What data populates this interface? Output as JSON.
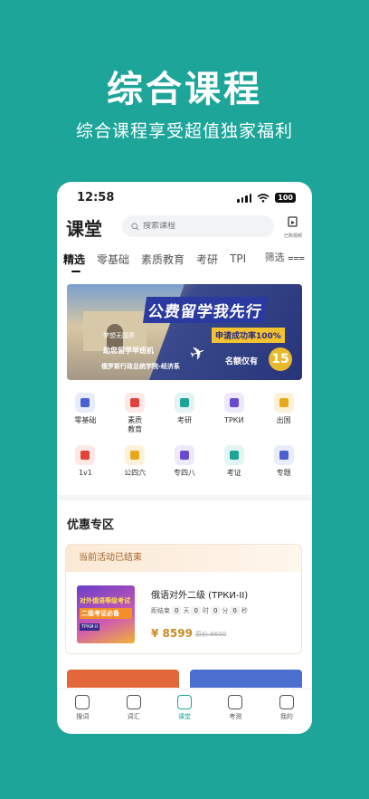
{
  "promo": {
    "title": "综合课程",
    "subtitle": "综合课程享受超值独家福利"
  },
  "status": {
    "time": "12:58",
    "battery": "100"
  },
  "header": {
    "title": "课堂",
    "search_placeholder": "搜索课程",
    "bought_label": "已购视频"
  },
  "tabs": [
    "精选",
    "零基础",
    "素质教育",
    "考研",
    "TPI"
  ],
  "filter_label": "筛选",
  "banner": {
    "title": "公费留学我先行",
    "tag1": "梦想无国界",
    "tag2": "助您留学早班机",
    "school": "俄罗斯行政总统学院-经济系",
    "rate": "申请成功率100%",
    "quota": "名额仅有",
    "quota_num": "15"
  },
  "categories": [
    [
      {
        "label": "零基础",
        "color": "#4a5fd0",
        "bg": "#e8ecfb"
      },
      {
        "label": "素质\n教育",
        "color": "#e2433a",
        "bg": "#fde8e6"
      },
      {
        "label": "考研",
        "color": "#1ea59a",
        "bg": "#e2f5f2"
      },
      {
        "label": "ТРКИ",
        "color": "#6a4bd0",
        "bg": "#eee9fb"
      },
      {
        "label": "出国",
        "color": "#e8a81c",
        "bg": "#fdf2d8"
      }
    ],
    [
      {
        "label": "1v1",
        "color": "#e2433a",
        "bg": "#fde8e6"
      },
      {
        "label": "公四六",
        "color": "#e8a81c",
        "bg": "#fdf2d8"
      },
      {
        "label": "专四八",
        "color": "#6a4bd0",
        "bg": "#eee9fb"
      },
      {
        "label": "考证",
        "color": "#1ea59a",
        "bg": "#e2f5f2"
      },
      {
        "label": "专题",
        "color": "#4a5fd0",
        "bg": "#e8ecfb"
      }
    ]
  ],
  "deals": {
    "section_title": "优惠专区",
    "status": "当前活动已结束",
    "course": {
      "title": "俄语对外二级 (ТРКИ-II)",
      "thumb_line1": "对外俄语等级考试",
      "thumb_line2": "二级考证必备",
      "thumb_line3": "ТРКИ-II",
      "countdown_prefix": "距结束",
      "days": "0",
      "day_unit": "天",
      "hours": "0",
      "hour_unit": "时",
      "minutes": "0",
      "minute_unit": "分",
      "seconds": "0",
      "second_unit": "秒",
      "price": "¥ 8599",
      "original_price": "原价:8600"
    }
  },
  "nav": [
    {
      "label": "搜词",
      "name": "nav-search-word"
    },
    {
      "label": "词汇",
      "name": "nav-vocabulary"
    },
    {
      "label": "课堂",
      "name": "nav-classroom",
      "active": true
    },
    {
      "label": "考测",
      "name": "nav-test"
    },
    {
      "label": "我的",
      "name": "nav-mine"
    }
  ],
  "colors": {
    "accent": "#1ea59a",
    "price": "#c98a1f"
  }
}
